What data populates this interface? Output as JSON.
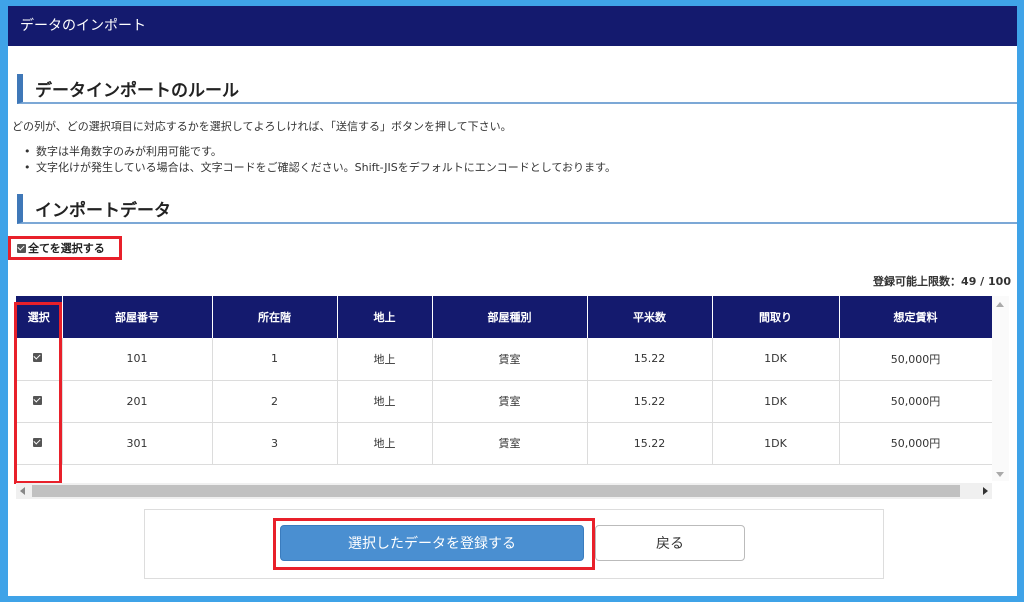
{
  "header": {
    "title": "データのインポート"
  },
  "rules": {
    "heading": "データインポートのルール",
    "intro": "どの列が、どの選択項目に対応するかを選択してよろしければ、「送信する」ボタンを押して下さい。",
    "items": [
      "数字は半角数字のみが利用可能です。",
      "文字化けが発生している場合は、文字コードをご確認ください。Shift-JISをデフォルトにエンコードとしております。"
    ]
  },
  "import": {
    "heading": "インポートデータ",
    "select_all_label": "全てを選択する",
    "select_all_checked": true,
    "limit_text": "登録可能上限数：49 / 100"
  },
  "table": {
    "columns": [
      "選択",
      "部屋番号",
      "所在階",
      "地上",
      "部屋種別",
      "平米数",
      "間取り",
      "想定賃料"
    ],
    "rows": [
      {
        "checked": true,
        "cells": [
          "101",
          "1",
          "地上",
          "賃室",
          "15.22",
          "1DK",
          "50,000円"
        ]
      },
      {
        "checked": true,
        "cells": [
          "201",
          "2",
          "地上",
          "賃室",
          "15.22",
          "1DK",
          "50,000円"
        ]
      },
      {
        "checked": true,
        "cells": [
          "301",
          "3",
          "地上",
          "賃室",
          "15.22",
          "1DK",
          "50,000円"
        ]
      }
    ]
  },
  "actions": {
    "submit_label": "選択したデータを登録する",
    "back_label": "戻る"
  },
  "colors": {
    "header_bg": "#141a6e",
    "accent": "#3f78b8",
    "highlight": "#e8202a",
    "primary_button": "#4a8fd1",
    "outer_bg": "#3fa3e8"
  }
}
